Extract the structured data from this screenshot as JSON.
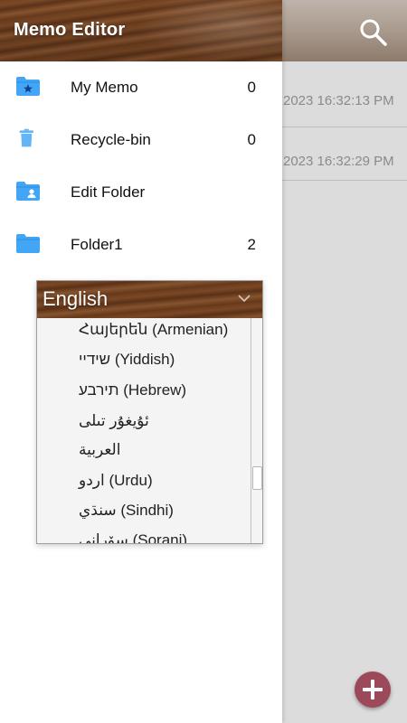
{
  "app": {
    "title": "Memo Editor"
  },
  "memos": [
    {
      "date": "2023 16:32:13 PM"
    },
    {
      "date": "2023 16:32:29 PM"
    }
  ],
  "folders": [
    {
      "name": "My Memo",
      "count": "0",
      "icon": "folder-star-icon"
    },
    {
      "name": "Recycle-bin",
      "count": "0",
      "icon": "trash-icon"
    },
    {
      "name": "Edit Folder",
      "count": "",
      "icon": "folder-person-icon"
    },
    {
      "name": "Folder1",
      "count": "2",
      "icon": "folder-icon"
    }
  ],
  "language": {
    "selected": "English",
    "options": [
      "Հայերեն (Armenian)",
      "שידיי (Yiddish)",
      "תירבע (Hebrew)",
      "ئۇيغۇر تىلى",
      "العربية",
      "اردو (Urdu)",
      "سنڌي (Sindhi)",
      "سۆرانی (Sorani)"
    ]
  },
  "colors": {
    "fab": "#9c4a5a",
    "folder_blue": "#42a5f5",
    "wood_dark": "#6b3d1f"
  }
}
